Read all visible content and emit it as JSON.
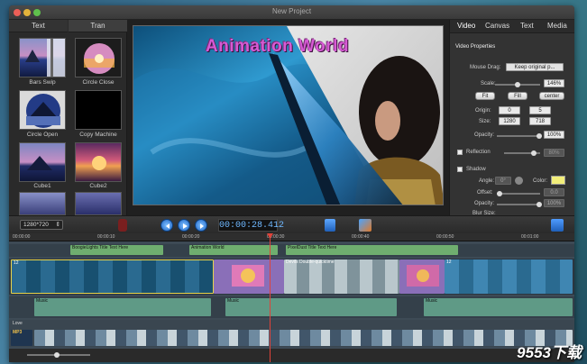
{
  "window": {
    "title": "New Project"
  },
  "left_panel": {
    "tabs": [
      "Text",
      "Tran"
    ],
    "active_tab": "Tran",
    "transitions": [
      {
        "label": "Bars Swip"
      },
      {
        "label": "Circle Close"
      },
      {
        "label": "Circle Open"
      },
      {
        "label": "Copy Machine"
      },
      {
        "label": "Cube1"
      },
      {
        "label": "Cube2"
      }
    ]
  },
  "preview": {
    "overlay_title": "Animation World"
  },
  "right_panel": {
    "tabs": [
      "Video",
      "Canvas",
      "Text",
      "Media"
    ],
    "active_tab": "Video",
    "section": "Video Properties",
    "mouse_drag_label": "Mouse Drag:",
    "mouse_drag_value": "Keep original p...",
    "scale_label": "Scale:",
    "scale_value": "146%",
    "fit": "Fit",
    "fill": "Fill",
    "center": "center",
    "origin_label": "Origin:",
    "origin_x": "0",
    "origin_y": "5",
    "size_label": "Size:",
    "size_w": "1280",
    "size_h": "718",
    "opacity_label": "Opacity:",
    "opacity_value": "100%",
    "reflection_label": "Reflection",
    "reflection_value": "80%",
    "shadow_label": "Shadow",
    "angle_label": "Angle:",
    "angle_value": "0°",
    "color_label": "Color:",
    "offset_label": "Offset:",
    "offset_value": "0.0",
    "shadow_opacity_label": "Opacity:",
    "shadow_opacity_value": "100%",
    "blur_label": "Blur Size:",
    "colors": {
      "shadow_swatch": "#f2ee7a"
    }
  },
  "controls": {
    "resolution": "1280*720",
    "timecode": "00:00:28.412"
  },
  "timeline": {
    "ruler": [
      "00:00:00",
      "00:00:10",
      "00:00:20",
      "00:00:30",
      "00:00:40",
      "00:00:50",
      "00:01:00"
    ],
    "text_clips": [
      "BoogieLights Title Text Here",
      "Animation World",
      "PixelDust Title Text Here"
    ],
    "video_track_label": "12",
    "video_clip_title": "Devils Double-quicktime",
    "video_track_label_2": "12",
    "music_label": "Music",
    "love_label": "Love",
    "mp3_label": "MP3"
  },
  "watermark": "9553下载"
}
